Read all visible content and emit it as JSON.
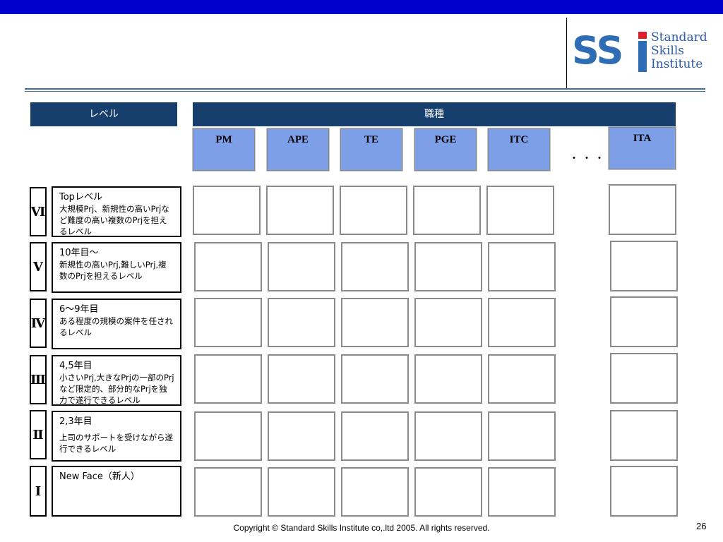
{
  "logo": {
    "mark": "SS",
    "text": [
      "Standard",
      "Skills",
      "Institute"
    ]
  },
  "headers": {
    "level": "レベル",
    "job_type": "職種"
  },
  "jobs": [
    "PM",
    "APE",
    "TE",
    "PGE",
    "ITC",
    "ITA"
  ],
  "ellipsis": "・・・",
  "levels": [
    {
      "roman": "Ⅵ",
      "title": "Topレベル",
      "desc": "大規模Prj、新規性の高いPrjなど難度の高い複数のPrjを担えるレベル"
    },
    {
      "roman": "Ⅴ",
      "title": "10年目～",
      "desc": "新規性の高いPrj,難しいPrj,複数のPrjを担えるレベル"
    },
    {
      "roman": "Ⅳ",
      "title": "6～9年目",
      "desc": "ある程度の規模の案件を任されるレベル"
    },
    {
      "roman": "Ⅲ",
      "title": "4,5年目",
      "desc": "小さいPrj,大きなPrjの一部のPrjなど限定的、部分的なPrjを独力で遂行できるレベル"
    },
    {
      "roman": "Ⅱ",
      "title": "2,3年目",
      "desc": "上司のサポートを受けながら遂行できるレベル"
    },
    {
      "roman": "Ⅰ",
      "title": "New Face（新人）",
      "desc": ""
    }
  ],
  "footer": "Copyright © Standard Skills Institute co,.ltd 2005. All rights reserved.",
  "page_number": "26"
}
